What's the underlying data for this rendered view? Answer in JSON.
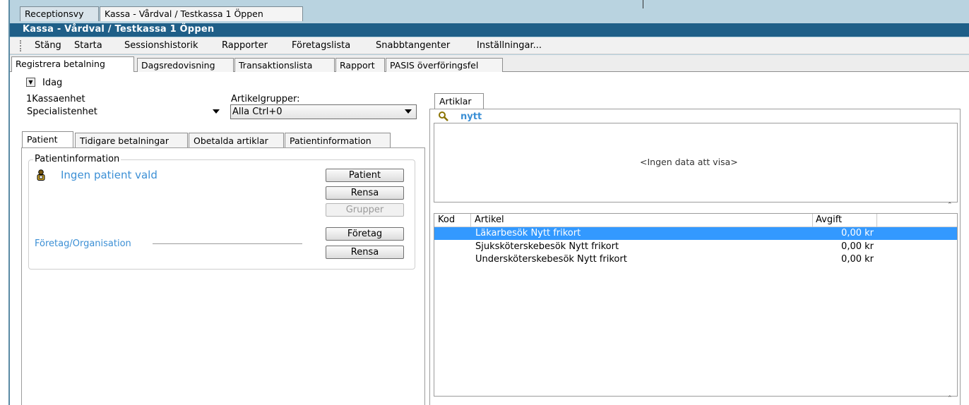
{
  "window": {
    "outer_tabs": [
      "Receptionsvy",
      "Kassa - Vårdval / Testkassa 1 Öppen"
    ],
    "title": "Kassa - Vårdval / Testkassa 1 Öppen"
  },
  "menu": {
    "items": [
      "Stäng",
      "Starta",
      "Sessionshistorik",
      "Rapporter",
      "Företagslista",
      "Snabbtangenter",
      "Inställningar..."
    ]
  },
  "tabs": {
    "items": [
      "Registrera betalning",
      "Dagsredovisning",
      "Transaktionslista",
      "Rapport",
      "PASIS överföringsfel"
    ]
  },
  "left": {
    "idag_label": "Idag",
    "kassaenhet_label": "1Kassaenhet",
    "kassaenhet_value": "Specialistenhet",
    "artikelgrupper_label": "Artikelgrupper:",
    "artikelgrupper_value": "Alla Ctrl+0",
    "patient_tabs": [
      "Patient",
      "Tidigare betalningar",
      "Obetalda artiklar",
      "Patientinformation"
    ],
    "patientinfo_legend": "Patientinformation",
    "no_patient": "Ingen patient vald",
    "buttons": {
      "patient": "Patient",
      "rensa1": "Rensa",
      "grupper": "Grupper",
      "foretag": "Företag",
      "rensa2": "Rensa"
    },
    "foretag_label": "Företag/Organisation"
  },
  "right": {
    "tab": "Artiklar",
    "search_text": "nytt",
    "empty_message": "<Ingen data att visa>",
    "columns": [
      "Kod",
      "Artikel",
      "Avgift"
    ],
    "rows": [
      {
        "kod": "",
        "artikel": "Läkarbesök Nytt frikort",
        "avgift": "0,00 kr"
      },
      {
        "kod": "",
        "artikel": "Sjuksköterskebesök Nytt frikort",
        "avgift": "0,00 kr"
      },
      {
        "kod": "",
        "artikel": "Undersköterskebesök Nytt frikort",
        "avgift": "0,00 kr"
      }
    ]
  },
  "colors": {
    "titlebar": "#1f5f88",
    "selection": "#3399ff",
    "link_blue": "#3b8fd5"
  }
}
